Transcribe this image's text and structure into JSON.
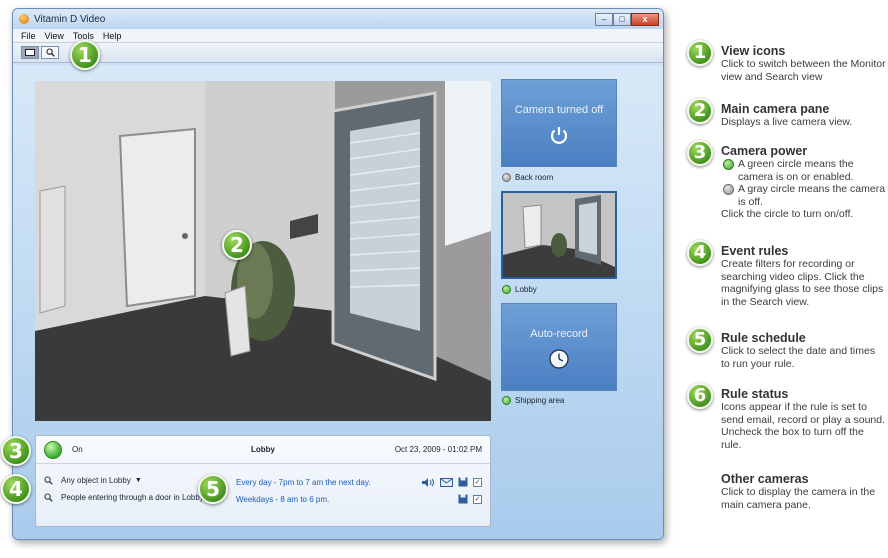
{
  "window": {
    "title": "Vitamin D Video",
    "controls": [
      "–",
      "□",
      "x"
    ]
  },
  "menu": [
    "File",
    "View",
    "Tools",
    "Help"
  ],
  "toolbar": {
    "view_icons": [
      "monitor-icon",
      "search-icon"
    ],
    "active": "monitor-icon"
  },
  "side_cameras": [
    {
      "name": "Back room",
      "status": "off",
      "tile_text": "Camera turned off",
      "icon": "power-icon"
    },
    {
      "name": "Lobby",
      "status": "on",
      "selected": true
    },
    {
      "name": "Shipping area",
      "status": "on",
      "tile_text": "Auto-record",
      "icon": "clock-icon"
    }
  ],
  "rules_panel": {
    "power_label": "On",
    "camera_name": "Lobby",
    "timestamp": "Oct 23, 2009 - 01:02 PM",
    "rules": [
      {
        "name": "Any object in Lobby",
        "has_dropdown": true,
        "schedule": "Every day - 7pm to 7 am the next day.",
        "icons": [
          "sound-icon",
          "email-icon",
          "record-icon"
        ],
        "enabled": true
      },
      {
        "name": "People entering through a door in Lobby",
        "has_dropdown": false,
        "schedule": "Weekdays - 8 am to 6 pm.",
        "icons": [
          "record-icon"
        ],
        "enabled": true
      }
    ]
  },
  "callouts": [
    "1",
    "2",
    "3",
    "4",
    "5",
    "6"
  ],
  "annotations": [
    {
      "number": "1",
      "title": "View icons",
      "text": "Click to switch between the Monitor view and Search view"
    },
    {
      "number": "2",
      "title": "Main camera pane",
      "text": "Displays a live camera view."
    },
    {
      "number": "3",
      "title": "Camera power",
      "legend_on": "A green circle means the camera is on or enabled.",
      "legend_off": "A gray circle means the camera is off.",
      "text": "Click the circle to turn on/off."
    },
    {
      "number": "4",
      "title": "Event rules",
      "text": "Create filters for recording or searching video clips. Click the magnifying glass to see those clips in the Search view."
    },
    {
      "number": "5",
      "title": "Rule schedule",
      "text": "Click to select the date and times to run your rule."
    },
    {
      "number": "6",
      "title": "Rule status",
      "text": "Icons appear if the rule is set to send email, record or play a sound.  Uncheck the box to turn off the rule."
    },
    {
      "number": "",
      "title": "Other cameras",
      "text": "Click to display the camera in the main camera pane."
    }
  ]
}
